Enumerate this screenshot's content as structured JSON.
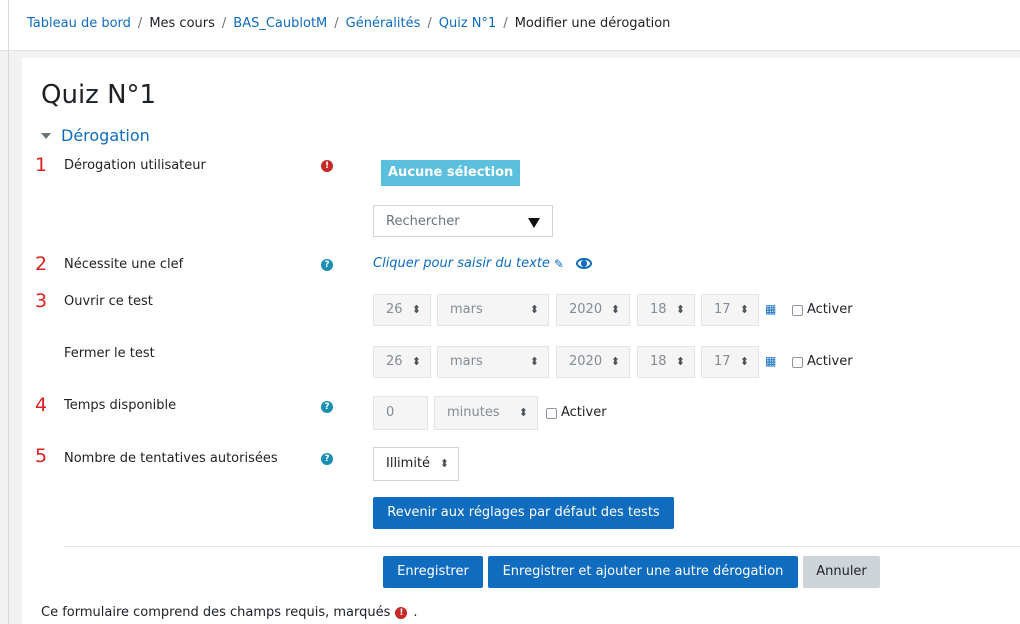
{
  "breadcrumb": {
    "items": [
      {
        "label": "Tableau de bord",
        "link": true
      },
      {
        "label": "Mes cours",
        "link": false
      },
      {
        "label": "BAS_CaublotM",
        "link": true
      },
      {
        "label": "Généralités",
        "link": true
      },
      {
        "label": "Quiz N°1",
        "link": true
      },
      {
        "label": "Modifier une dérogation",
        "link": false
      }
    ],
    "separator": "/"
  },
  "page": {
    "title": "Quiz N°1"
  },
  "section": {
    "title": "Dérogation"
  },
  "annotations": {
    "n1": "1",
    "n2": "2",
    "n3": "3",
    "n4": "4",
    "n5": "5"
  },
  "icons": {
    "required": "exclamation-circle-icon",
    "help": "question-circle-icon",
    "calendar": "calendar-icon",
    "edit": "pencil-icon",
    "preview": "eye-icon"
  },
  "fields": {
    "user": {
      "label": "Dérogation utilisateur",
      "badge": "Aucune sélection",
      "search_placeholder": "Rechercher"
    },
    "password": {
      "label": "Nécessite une clef",
      "inplace_text": "Cliquer pour saisir du texte"
    },
    "open": {
      "label": "Ouvrir ce test",
      "day": "26",
      "month": "mars",
      "year": "2020",
      "hour": "18",
      "minute": "17",
      "enable_label": "Activer",
      "enabled": false
    },
    "close": {
      "label": "Fermer le test",
      "day": "26",
      "month": "mars",
      "year": "2020",
      "hour": "18",
      "minute": "17",
      "enable_label": "Activer",
      "enabled": false
    },
    "timelimit": {
      "label": "Temps disponible",
      "value": "0",
      "unit": "minutes",
      "enable_label": "Activer",
      "enabled": false
    },
    "attempts": {
      "label": "Nombre de tentatives autorisées",
      "value": "Illimité"
    }
  },
  "buttons": {
    "reset": "Revenir aux réglages par défaut des tests",
    "save": "Enregistrer",
    "save_another": "Enregistrer et ajouter une autre dérogation",
    "cancel": "Annuler"
  },
  "footer": {
    "note_before": "Ce formulaire comprend des champs requis, marqués",
    "note_after": "."
  },
  "colors": {
    "primary": "#0f6cbf",
    "info_badge": "#5bc0de",
    "required": "#c62828",
    "help": "#1a8fb3",
    "annotation": "#e02020"
  }
}
